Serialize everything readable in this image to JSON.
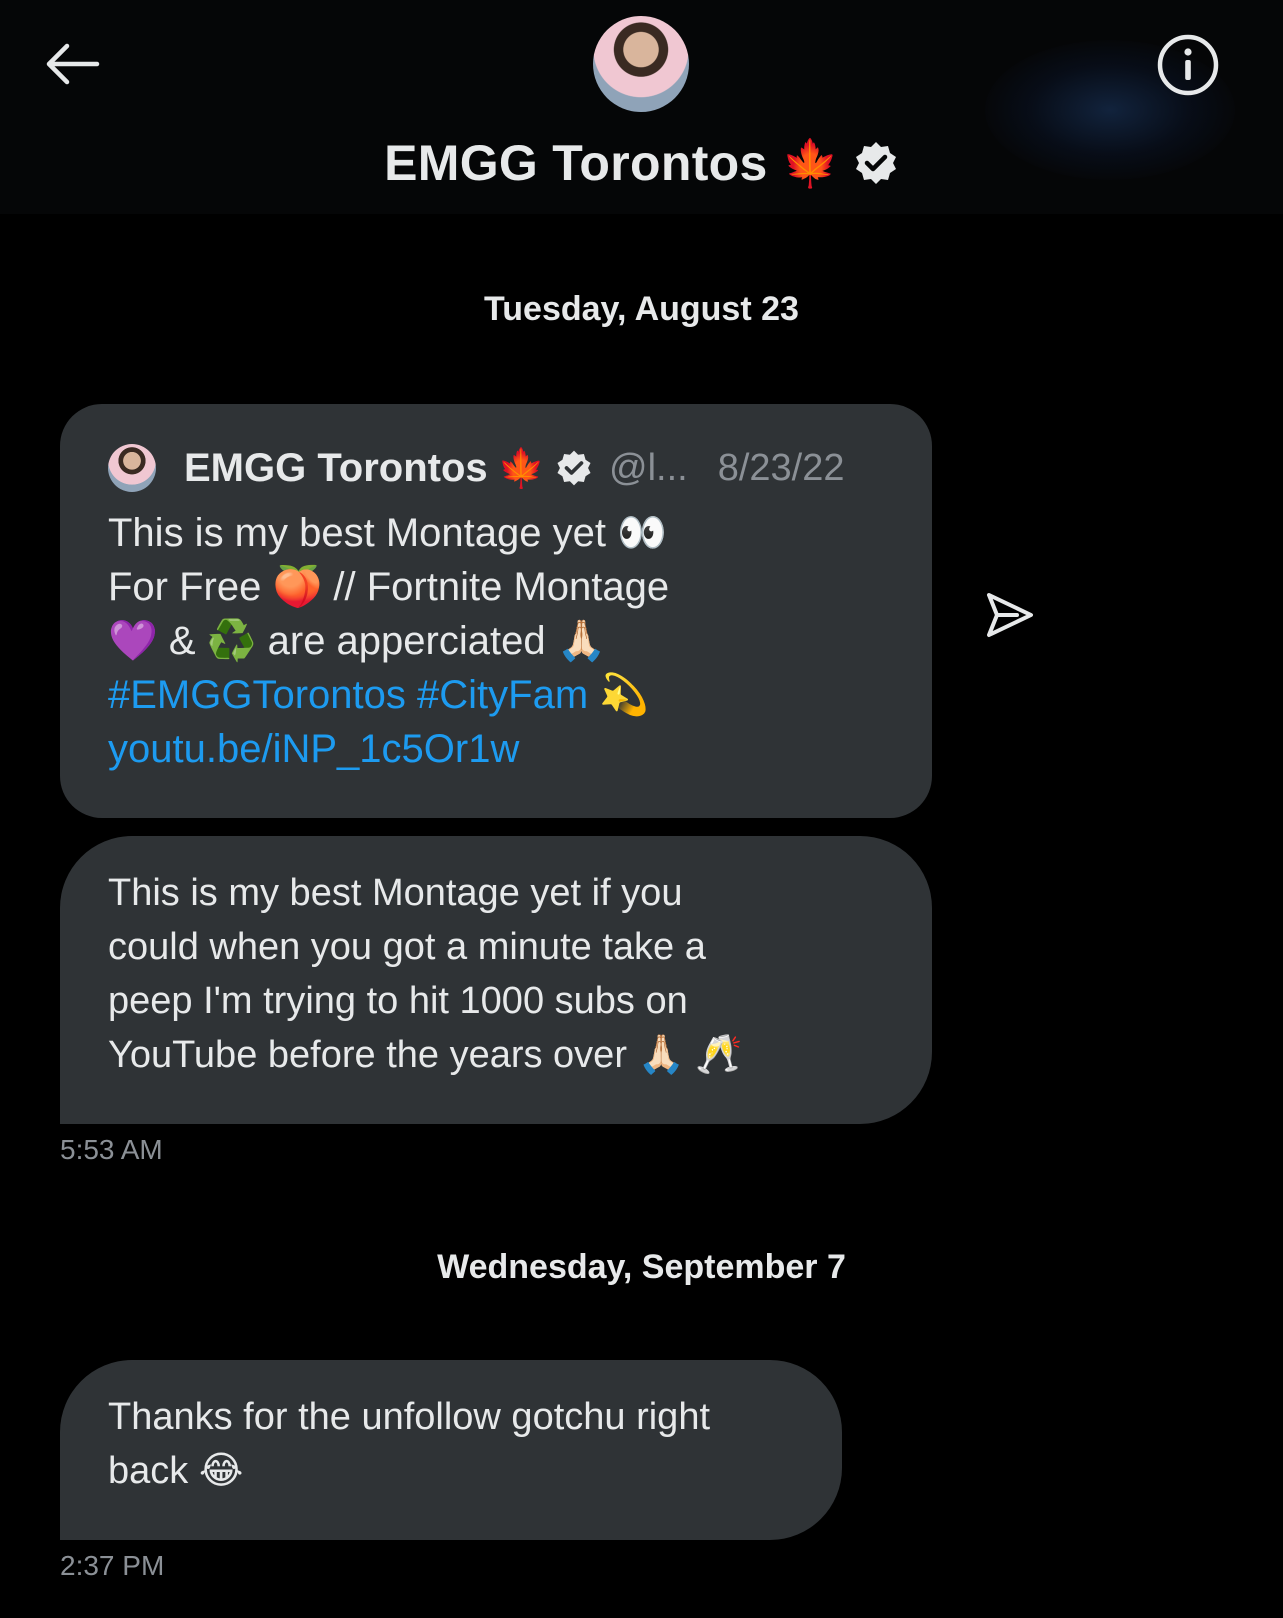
{
  "header": {
    "title": "EMGG Torontos",
    "title_emoji": "🍁",
    "back_icon": "back-arrow-icon",
    "info_icon": "info-icon",
    "verified_icon": "verified-badge-icon"
  },
  "dates": {
    "first": "Tuesday, August 23",
    "second": "Wednesday, September 7"
  },
  "quoted_tweet": {
    "author_name": "EMGG Torontos",
    "author_emoji": "🍁",
    "handle": "@l...",
    "date": "8/23/22",
    "lines": [
      "This is my best Montage yet 👀",
      "For Free 🍑 // Fortnite Montage",
      "💜 & ♻️ are apperciated 🙏🏻"
    ],
    "hashtags": "#EMGGTorontos #CityFam",
    "hashtag_emoji": "💫",
    "link": "youtu.be/iNP_1c5Or1w"
  },
  "messages": [
    {
      "lines": [
        "This is my best Montage yet if you",
        "could when you got a minute take a",
        "peep I'm trying to hit 1000 subs on",
        "YouTube before the years over 🙏🏻 🥂"
      ],
      "time": "5:53 AM"
    },
    {
      "lines": [
        "Thanks for the unfollow gotchu right",
        "back 😂"
      ],
      "time": "2:37 PM"
    }
  ],
  "colors": {
    "background": "#000000",
    "bubble": "#2f3336",
    "text": "#e7e9ea",
    "muted": "#8b9096",
    "link": "#1d9bf0"
  }
}
